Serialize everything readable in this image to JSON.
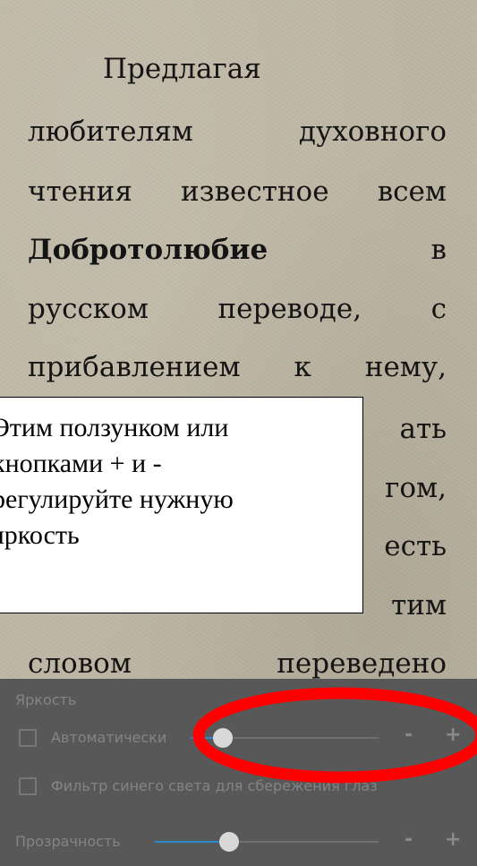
{
  "book": {
    "lines": [
      [
        "Предлагая"
      ],
      [
        "любителям",
        "духовного"
      ],
      [
        "чтения",
        "известное",
        "всем"
      ],
      [
        "Добротолюбие",
        "в"
      ],
      [
        "русском",
        "переводе,",
        "с"
      ],
      [
        "прибавлением",
        "к",
        "нему,"
      ],
      [
        "",
        "ать"
      ],
      [
        "",
        "гом,"
      ],
      [
        "",
        "есть"
      ],
      [
        "",
        "тим"
      ],
      [
        "словом",
        "переведено"
      ]
    ]
  },
  "callout": {
    "lines": [
      "Этим ползунком или",
      "кнопками + и  -",
      "регулируйте нужную",
      "яркость"
    ]
  },
  "panel": {
    "title": "Яркость",
    "auto_label": "Автоматически",
    "bluefilter_label": "Фильтр синего света для сбережения глаз",
    "transparency_label": "Прозрачность",
    "minus": "-",
    "plus": "+",
    "brightness_level": 0.17,
    "transparency_level": 0.33
  },
  "colors": {
    "slider_accent": "#2a8ad0",
    "highlight_ring": "#ff0000",
    "panel_bg": "#585858",
    "page_bg": "#bdb6a3"
  }
}
